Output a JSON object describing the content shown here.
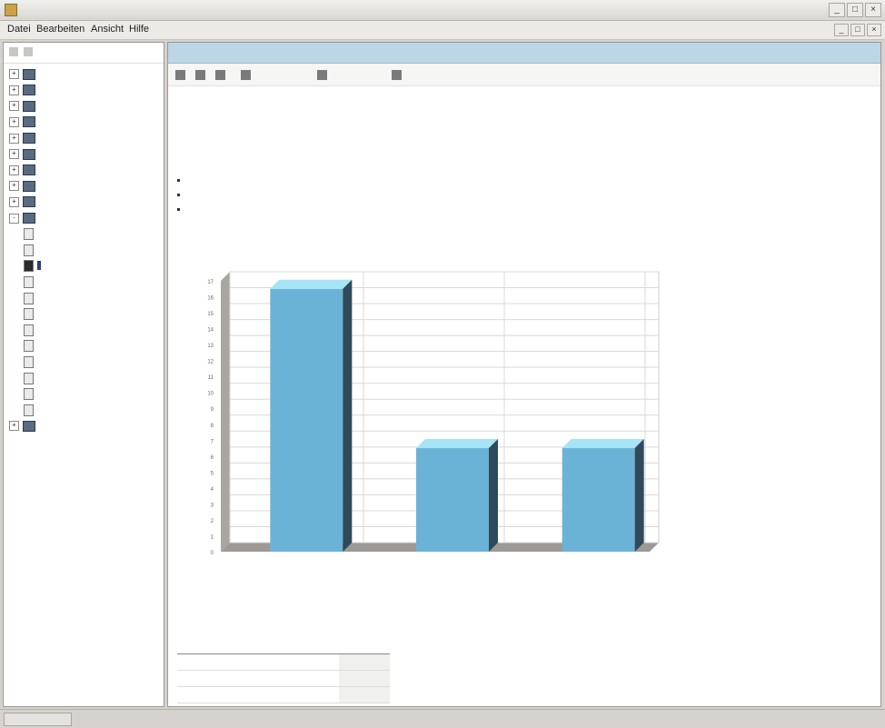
{
  "window": {
    "title": "",
    "controls": [
      "minimize",
      "maximize",
      "close"
    ]
  },
  "menubar": {
    "items": [
      "Datei",
      "Bearbeiten",
      "Ansicht",
      "Hilfe"
    ]
  },
  "tree": {
    "items": [
      {
        "label": "",
        "level": 0,
        "expander": "+",
        "icon": "folder-icon"
      },
      {
        "label": "",
        "level": 0,
        "expander": "+",
        "icon": "folder-icon"
      },
      {
        "label": "",
        "level": 0,
        "expander": "+",
        "icon": "folder-icon"
      },
      {
        "label": "",
        "level": 0,
        "expander": "+",
        "icon": "folder-icon"
      },
      {
        "label": "",
        "level": 0,
        "expander": "+",
        "icon": "folder-icon"
      },
      {
        "label": "",
        "level": 0,
        "expander": "+",
        "icon": "folder-icon"
      },
      {
        "label": "",
        "level": 0,
        "expander": "+",
        "icon": "folder-icon"
      },
      {
        "label": "",
        "level": 0,
        "expander": "+",
        "icon": "folder-icon"
      },
      {
        "label": "",
        "level": 0,
        "expander": "+",
        "icon": "folder-icon"
      },
      {
        "label": "",
        "level": 0,
        "expander": "-",
        "icon": "folder-icon"
      },
      {
        "label": "",
        "level": 1,
        "expander": "",
        "icon": "document-icon"
      },
      {
        "label": "",
        "level": 1,
        "expander": "",
        "icon": "document-icon"
      },
      {
        "label": "",
        "level": 1,
        "expander": "",
        "icon": "document-icon",
        "selected": true
      },
      {
        "label": "",
        "level": 1,
        "expander": "",
        "icon": "document-icon"
      },
      {
        "label": "",
        "level": 1,
        "expander": "",
        "icon": "document-icon"
      },
      {
        "label": "",
        "level": 1,
        "expander": "",
        "icon": "document-icon"
      },
      {
        "label": "",
        "level": 1,
        "expander": "",
        "icon": "document-icon"
      },
      {
        "label": "",
        "level": 1,
        "expander": "",
        "icon": "document-icon"
      },
      {
        "label": "",
        "level": 1,
        "expander": "",
        "icon": "document-icon"
      },
      {
        "label": "",
        "level": 1,
        "expander": "",
        "icon": "document-icon"
      },
      {
        "label": "",
        "level": 1,
        "expander": "",
        "icon": "document-icon"
      },
      {
        "label": "",
        "level": 1,
        "expander": "",
        "icon": "document-icon"
      },
      {
        "label": "",
        "level": 0,
        "expander": "+",
        "icon": "folder-icon"
      }
    ]
  },
  "content": {
    "breadcrumb": "",
    "toolbar": {
      "items": [
        {
          "label": "",
          "icon": "back-icon"
        },
        {
          "label": "",
          "icon": "forward-icon"
        },
        {
          "label": "",
          "icon": "refresh-icon"
        },
        {
          "label": "",
          "icon": "export-icon"
        },
        {
          "label": "",
          "icon": "print-icon"
        },
        {
          "label": "",
          "icon": "help-icon"
        }
      ]
    },
    "title": "",
    "description": "",
    "meta": [
      {
        "key": "",
        "value": ""
      },
      {
        "key": "",
        "value": ""
      },
      {
        "key": "",
        "value": ""
      }
    ]
  },
  "chart_data": {
    "type": "bar",
    "categories": [
      "",
      "",
      ""
    ],
    "values": [
      16.5,
      6.5,
      6.5
    ],
    "ylim": [
      0,
      17
    ],
    "yticks": [
      "0",
      "1",
      "2",
      "3",
      "4",
      "5",
      "6",
      "7",
      "8",
      "9",
      "10",
      "11",
      "12",
      "13",
      "14",
      "15",
      "16",
      "17"
    ],
    "grid": true,
    "colors": {
      "bar": "#6bb3d6",
      "bar_top": "#a6e4f6",
      "bar_side": "#2f4a5a",
      "wall": "#a9a6a1",
      "floor": "#9d9a95",
      "grid": "#d8d8d8"
    }
  },
  "table": {
    "headers": [
      "",
      "",
      ""
    ],
    "rows": [
      [
        "",
        "",
        ""
      ],
      [
        "",
        "",
        ""
      ],
      [
        "",
        "",
        ""
      ]
    ]
  },
  "statusbar": {
    "text": ""
  }
}
